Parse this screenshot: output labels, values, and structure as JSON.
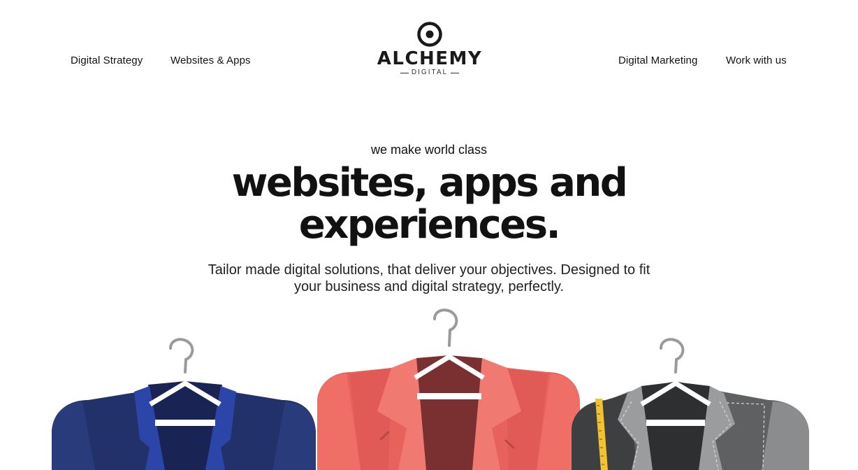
{
  "nav": {
    "left": [
      {
        "label": "Digital Strategy"
      },
      {
        "label": "Websites & Apps"
      }
    ],
    "right": [
      {
        "label": "Digital Marketing"
      },
      {
        "label": "Work with us"
      }
    ]
  },
  "logo": {
    "wordmark": "ALCHEMY",
    "sub": "DIGITAL"
  },
  "hero": {
    "kicker": "we make world class",
    "title_line1": "websites, apps and",
    "title_line2": "experiences.",
    "description_line1": "Tailor made digital solutions, that deliver your objectives. Designed to fit",
    "description_line2": "your business and digital strategy, perfectly."
  },
  "illustration": {
    "items": [
      {
        "name": "navy-jacket",
        "color": "#22316a"
      },
      {
        "name": "red-jacket",
        "color": "#e8625c"
      },
      {
        "name": "grey-jacket",
        "color": "#8a8c8e"
      }
    ],
    "hanger_color": "#9a9a9a",
    "tape_color": "#f2c230"
  }
}
